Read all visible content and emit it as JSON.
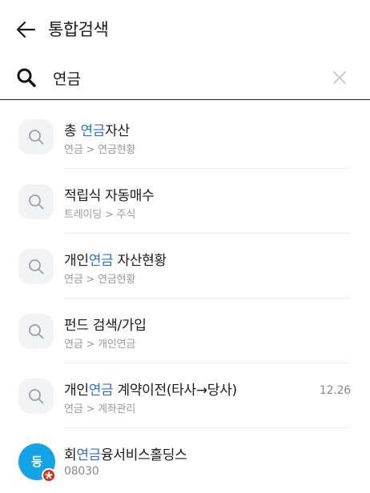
{
  "header": {
    "title": "통합검색"
  },
  "search": {
    "value": "연금",
    "placeholder": ""
  },
  "results": [
    {
      "main_pre": "총 ",
      "main_hl": "연금",
      "main_post": "자산",
      "sub": "연금 > 연금현황",
      "date": ""
    },
    {
      "main_pre": "적립식 자동매수",
      "main_hl": "",
      "main_post": "",
      "sub": "트레이딩 > 주식",
      "date": ""
    },
    {
      "main_pre": "개인",
      "main_hl": "연금",
      "main_post": " 자산현황",
      "sub": "연금 > 연금현황",
      "date": ""
    },
    {
      "main_pre": "펀드 검색/가입",
      "main_hl": "",
      "main_post": "",
      "sub": "연금 > 개인연금",
      "date": ""
    },
    {
      "main_pre": "개인",
      "main_hl": "연금",
      "main_post": " 계약이전(타사→당사)",
      "sub": "연금 > 계좌관리",
      "date": "12.26"
    },
    {
      "main_pre": "회",
      "main_hl": "연금",
      "main_post": "융서비스홀딩스",
      "sub": "08030",
      "date": "",
      "logo_text": "등"
    }
  ],
  "colors": {
    "highlight": "#2f6fd0",
    "stock_logo": "#14a3e6",
    "flag": "#de2910"
  },
  "icons": [
    "back-arrow-icon",
    "search-icon",
    "clear-icon",
    "menu-search-icon",
    "hong-kong-flag-icon"
  ]
}
